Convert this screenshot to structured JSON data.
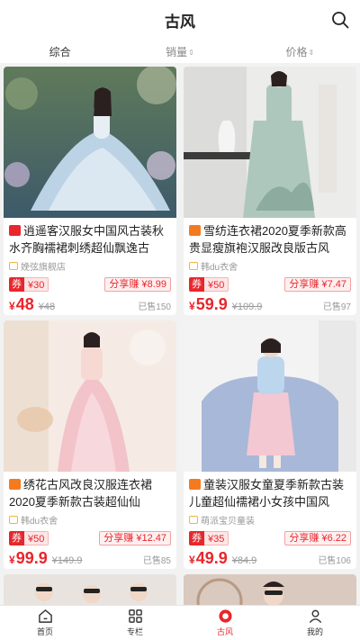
{
  "header": {
    "title": "古风"
  },
  "sort_tabs": [
    {
      "label": "综合"
    },
    {
      "label": "销量"
    },
    {
      "label": "价格"
    }
  ],
  "products": [
    {
      "platform": "tmall",
      "title": "逍遥客汉服女中国风古装秋水齐胸襦裙刺绣超仙飘逸古",
      "shop": "娩弦旗舰店",
      "coupon_label": "券",
      "coupon_value": "¥30",
      "share": "分享赚 ¥8.99",
      "price_symbol": "¥",
      "price": "48",
      "original": "¥48",
      "sold": "已售150"
    },
    {
      "platform": "taobao",
      "title": "雪纺连衣裙2020夏季新款高贵显瘦旗袍汉服改良版古风",
      "shop": "韩du衣舍",
      "coupon_label": "券",
      "coupon_value": "¥50",
      "share": "分享赚 ¥7.47",
      "price_symbol": "¥",
      "price": "59.9",
      "original": "¥109.9",
      "sold": "已售97"
    },
    {
      "platform": "taobao",
      "title": "绣花古风改良汉服连衣裙2020夏季新款古装超仙仙",
      "shop": "韩du衣舍",
      "coupon_label": "券",
      "coupon_value": "¥50",
      "share": "分享赚 ¥12.47",
      "price_symbol": "¥",
      "price": "99.9",
      "original": "¥149.9",
      "sold": "已售85"
    },
    {
      "platform": "taobao",
      "title": "童装汉服女童夏季新款古装儿童超仙襦裙小女孩中国风",
      "shop": "萌派宝贝童装",
      "coupon_label": "券",
      "coupon_value": "¥35",
      "share": "分享赚 ¥6.22",
      "price_symbol": "¥",
      "price": "49.9",
      "original": "¥84.9",
      "sold": "已售106"
    }
  ],
  "tabbar": [
    {
      "label": "首页",
      "icon": "home-icon"
    },
    {
      "label": "专栏",
      "icon": "grid-icon"
    },
    {
      "label": "古风",
      "icon": "target-icon",
      "active": true
    },
    {
      "label": "我的",
      "icon": "user-icon"
    }
  ],
  "colors": {
    "accent": "#e8262c",
    "coupon_bg": "#fde6e6",
    "page_bg": "#f2f2f2"
  }
}
